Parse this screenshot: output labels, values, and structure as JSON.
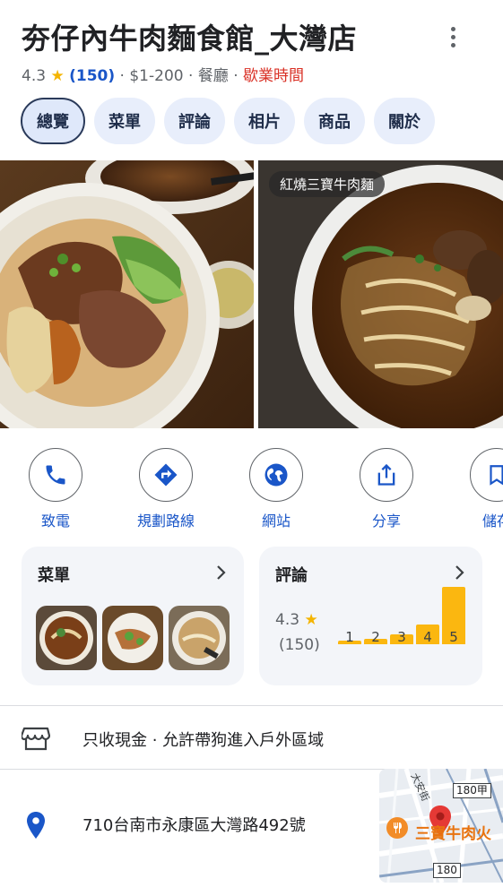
{
  "place": {
    "title": "夯仔內牛肉麵食館_大灣店",
    "rating": "4.3",
    "star": "★",
    "review_count": "(150)",
    "price": "$1-200",
    "category": "餐廳",
    "hours": "歇業時間",
    "sep": "·"
  },
  "tabs": [
    {
      "label": "總覽"
    },
    {
      "label": "菜單"
    },
    {
      "label": "評論"
    },
    {
      "label": "相片"
    },
    {
      "label": "商品"
    },
    {
      "label": "關於"
    }
  ],
  "photos": {
    "label": "紅燒三寶牛肉麵"
  },
  "actions": [
    {
      "label": "致電",
      "icon": "phone-icon"
    },
    {
      "label": "規劃路線",
      "icon": "directions-icon"
    },
    {
      "label": "網站",
      "icon": "globe-icon"
    },
    {
      "label": "分享",
      "icon": "share-icon"
    },
    {
      "label": "儲存",
      "icon": "bookmark-icon"
    }
  ],
  "menu_card": {
    "title": "菜單"
  },
  "reviews_card": {
    "title": "評論",
    "rating": "4.3",
    "star": "★",
    "count": "(150)",
    "distribution": [
      {
        "stars": "1",
        "share": 0.06
      },
      {
        "stars": "2",
        "share": 0.1
      },
      {
        "stars": "3",
        "share": 0.17
      },
      {
        "stars": "4",
        "share": 0.35
      },
      {
        "stars": "5",
        "share": 1.0
      }
    ]
  },
  "info": {
    "features": "只收現金 · 允許帶狗進入戶外區域",
    "address": "710台南市永康區大灣路492號"
  },
  "map": {
    "road_name": "大安街",
    "shield_1": "180甲",
    "shield_2": "180",
    "place_label": "三寶牛肉火"
  },
  "colors": {
    "accent": "#1a56c8",
    "hours": "#d93025",
    "star": "#f4b400",
    "bar": "#fbb710",
    "tab_bg": "#e8eefb",
    "pin": "#e53935"
  }
}
